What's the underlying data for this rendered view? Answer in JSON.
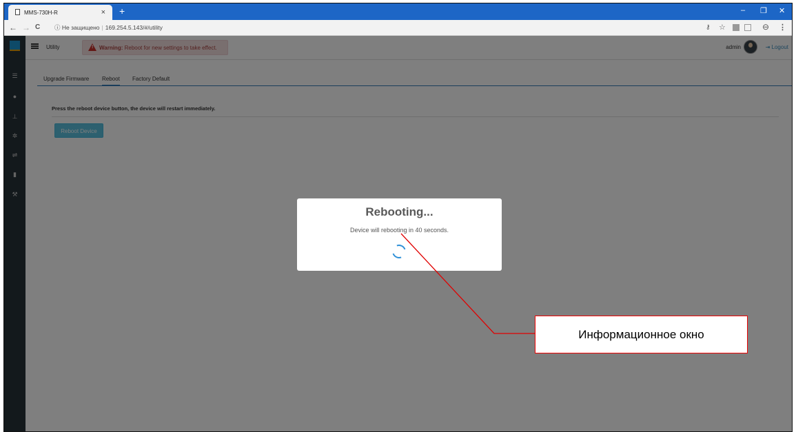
{
  "browser": {
    "tab_title": "MMS-730H-R",
    "tab_close": "×",
    "new_tab": "+",
    "window_controls": {
      "minimize": "–",
      "restore": "❐",
      "close": "✕"
    },
    "nav": {
      "back": "←",
      "forward": "→",
      "reload": "C",
      "info_icon": "ⓘ"
    },
    "security_label": "Не защищено",
    "url": "169.254.5.143/#/utility",
    "toolbar_icons": [
      "key-icon",
      "star-icon",
      "pdf-extension-icon",
      "image-extension-icon",
      "account-icon",
      "menu-icon"
    ]
  },
  "app": {
    "sidebar_icons": [
      "logo-icon",
      "list-icon",
      "user-icon",
      "network-icon",
      "settings-icon",
      "usb-icon",
      "database-icon",
      "wrench-icon"
    ],
    "page_label": "Utility",
    "warning": {
      "strong": "Warning:",
      "text": "Reboot for new settings to take effect."
    },
    "username": "admin",
    "logout_label": "Logout",
    "tabs": [
      "Upgrade Firmware",
      "Reboot",
      "Factory Default"
    ],
    "active_tab": "Reboot",
    "instruction": "Press the reboot device button, the device will restart immediately.",
    "reboot_button": "Reboot Device"
  },
  "modal": {
    "title": "Rebooting...",
    "message": "Device will rebooting in 40 seconds."
  },
  "annotation": {
    "label": "Информационное окно",
    "color": "#e00000"
  }
}
